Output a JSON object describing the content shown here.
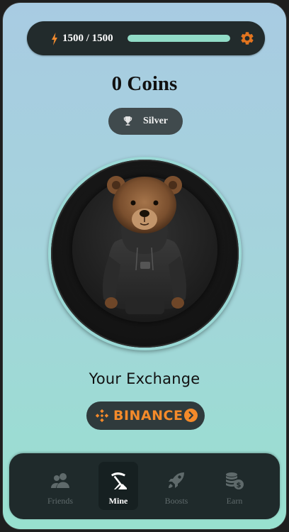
{
  "energy": {
    "text": "1500 / 1500",
    "current": 1500,
    "max": 1500,
    "fill_fraction": 1.0,
    "bar_color": "#92dcc7",
    "icon": "lightning-bolt-icon",
    "icon_color": "#f08a2e"
  },
  "settings": {
    "icon": "gear-icon",
    "icon_color": "#e2741f"
  },
  "coins": {
    "text": "0 Coins"
  },
  "rank": {
    "label": "Silver",
    "icon": "trophy-icon"
  },
  "exchange": {
    "title": "Your Exchange",
    "name": "BINANCE",
    "brand_color": "#f48a2a",
    "icon": "binance-logo-icon"
  },
  "nav": {
    "items": [
      {
        "label": "Friends",
        "icon": "friends-icon",
        "active": false
      },
      {
        "label": "Mine",
        "icon": "pickaxe-icon",
        "active": true
      },
      {
        "label": "Boosts",
        "icon": "rocket-icon",
        "active": false
      },
      {
        "label": "Earn",
        "icon": "coins-stack-icon",
        "active": false
      }
    ]
  }
}
